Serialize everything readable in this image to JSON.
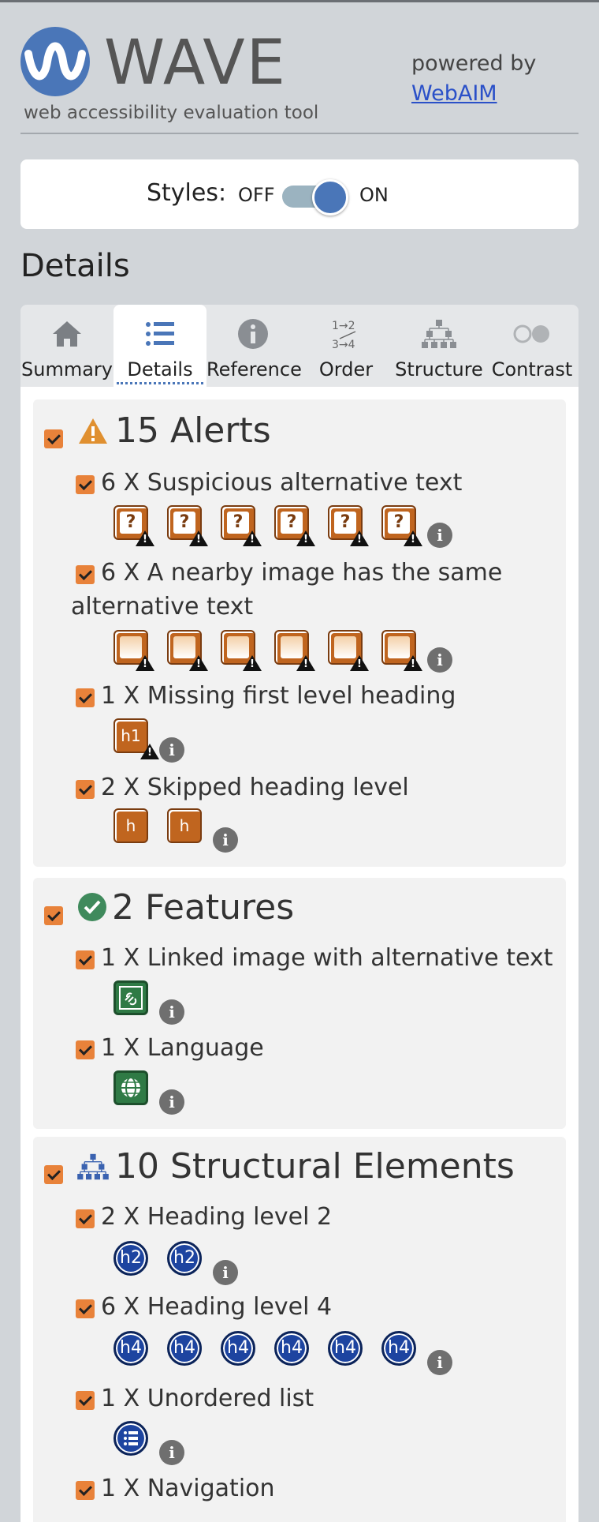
{
  "header": {
    "logo_text": "WAVE",
    "tagline": "web accessibility evaluation tool",
    "powered_by": "powered by",
    "powered_link": "WebAIM"
  },
  "styles": {
    "label": "Styles:",
    "off": "OFF",
    "on": "ON",
    "state": "on"
  },
  "page_title": "Details",
  "tabs": [
    {
      "label": "Summary",
      "icon": "home-icon"
    },
    {
      "label": "Details",
      "icon": "list-icon",
      "active": true
    },
    {
      "label": "Reference",
      "icon": "info-icon"
    },
    {
      "label": "Order",
      "icon": "order-icon"
    },
    {
      "label": "Structure",
      "icon": "structure-icon"
    },
    {
      "label": "Contrast",
      "icon": "contrast-icon"
    }
  ],
  "sections": {
    "alerts": {
      "title": "15 Alerts",
      "items": [
        {
          "label": "6 X Suspicious alternative text",
          "count": 6,
          "icon_text": "?"
        },
        {
          "label": "6 X A nearby image has the same",
          "label2": "alternative text",
          "count": 6
        },
        {
          "label": "1 X Missing first level heading",
          "count": 1,
          "icon_text": "h1"
        },
        {
          "label": "2 X Skipped heading level",
          "count": 2,
          "icon_text": "h"
        }
      ]
    },
    "features": {
      "title": "2 Features",
      "items": [
        {
          "label": "1 X Linked image with alternative text",
          "count": 1
        },
        {
          "label": "1 X Language",
          "count": 1
        }
      ]
    },
    "structure": {
      "title": "10 Structural Elements",
      "items": [
        {
          "label": "2 X Heading level 2",
          "count": 2,
          "icon_text": "h2"
        },
        {
          "label": "6 X Heading level 4",
          "count": 6,
          "icon_text": "h4"
        },
        {
          "label": "1 X Unordered list",
          "count": 1
        },
        {
          "label": "1 X Navigation",
          "count": 1
        }
      ]
    }
  },
  "info_glyph": "i"
}
